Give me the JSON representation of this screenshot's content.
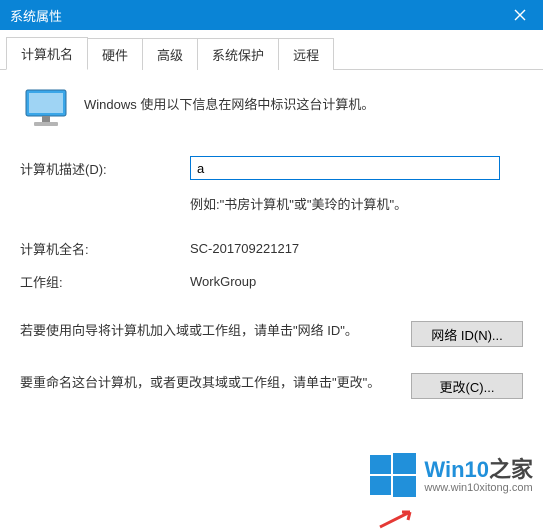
{
  "titlebar": {
    "title": "系统属性"
  },
  "tabs": {
    "items": [
      {
        "label": "计算机名"
      },
      {
        "label": "硬件"
      },
      {
        "label": "高级"
      },
      {
        "label": "系统保护"
      },
      {
        "label": "远程"
      }
    ]
  },
  "intro": {
    "text": "Windows 使用以下信息在网络中标识这台计算机。"
  },
  "description": {
    "label": "计算机描述(D):",
    "value": "a",
    "example": "例如:\"书房计算机\"或\"美玲的计算机\"。"
  },
  "fullname": {
    "label": "计算机全名:",
    "value": "SC-201709221217"
  },
  "workgroup": {
    "label": "工作组:",
    "value": "WorkGroup"
  },
  "network_id": {
    "text": "若要使用向导将计算机加入域或工作组，请单击\"网络 ID\"。",
    "button": "网络 ID(N)..."
  },
  "change": {
    "text": "要重命名这台计算机，或者更改其域或工作组，请单击\"更改\"。",
    "button": "更改(C)..."
  },
  "watermark": {
    "brand_prefix": "Win10",
    "brand_suffix": "之家",
    "url": "www.win10xitong.com"
  }
}
